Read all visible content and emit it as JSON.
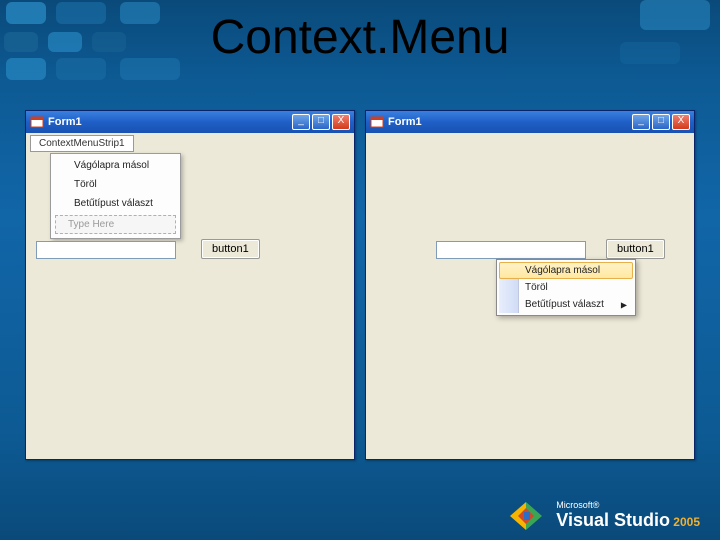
{
  "slide": {
    "title": "Context.Menu"
  },
  "window_left": {
    "title": "Form1",
    "min_label": "_",
    "max_label": "□",
    "close_label": "X",
    "menustrip_caption": "ContextMenuStrip1",
    "menu_items": [
      "Vágólapra másol",
      "Töröl",
      "Betűtípust választ"
    ],
    "typehere": "Type Here",
    "button_label": "button1"
  },
  "window_right": {
    "title": "Form1",
    "min_label": "_",
    "max_label": "□",
    "close_label": "X",
    "button_label": "button1",
    "context_items": [
      {
        "label": "Vágólapra másol",
        "hover": true
      },
      {
        "label": "Töröl",
        "hover": false
      },
      {
        "label": "Betűtípust választ",
        "hover": false,
        "submenu": true
      }
    ]
  },
  "footer": {
    "microsoft": "Microsoft®",
    "product": "Visual Studio",
    "year": "2005"
  }
}
